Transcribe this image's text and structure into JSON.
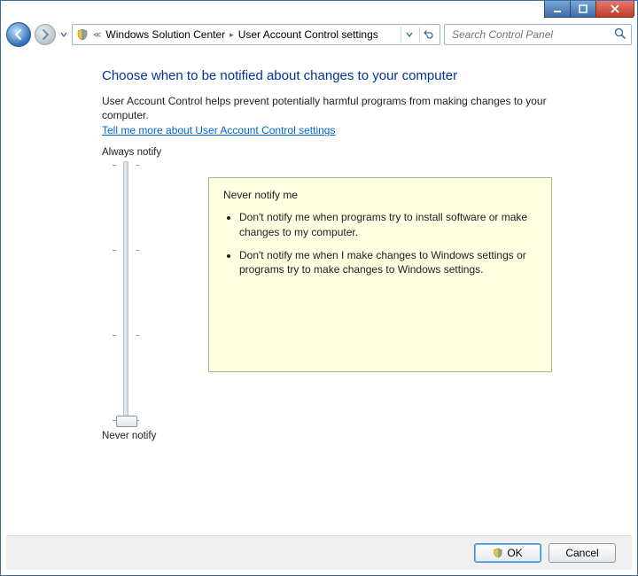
{
  "titlebar": {
    "minimize_tip": "Minimize",
    "maximize_tip": "Maximize",
    "close_tip": "Close"
  },
  "nav": {
    "breadcrumb_icon": "shield-icon",
    "crumb1": "Windows Solution Center",
    "crumb2": "User Account Control settings"
  },
  "search": {
    "placeholder": "Search Control Panel"
  },
  "page": {
    "heading": "Choose when to be notified about changes to your computer",
    "intro": "User Account Control helps prevent potentially harmful programs from making changes to your computer.",
    "link": "Tell me more about User Account Control settings"
  },
  "slider": {
    "top_label": "Always notify",
    "bottom_label": "Never notify",
    "levels": 4,
    "current_level": 0
  },
  "info": {
    "title": "Never notify me",
    "bullet1": "Don't notify me when programs try to install software or make changes to my computer.",
    "bullet2": "Don't notify me when I make changes to Windows settings or programs try to make changes to Windows settings."
  },
  "buttons": {
    "ok": "OK",
    "cancel": "Cancel"
  },
  "icons": {
    "back": "back-arrow-icon",
    "forward": "forward-arrow-icon",
    "dropdown": "chevron-down-icon",
    "refresh": "refresh-icon",
    "search": "search-icon"
  }
}
